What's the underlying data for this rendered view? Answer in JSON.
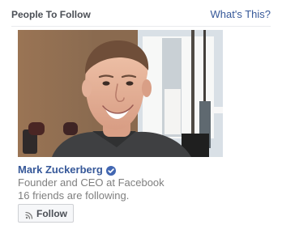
{
  "header": {
    "title": "People To Follow",
    "help_link": "What's This?"
  },
  "suggestion": {
    "name": "Mark Zuckerberg",
    "verified_icon": "verified-badge-icon",
    "description": "Founder and CEO at Facebook",
    "followers_text": "16 friends are following.",
    "follow_button": {
      "icon": "rss-icon",
      "label": "Follow"
    }
  },
  "colors": {
    "link": "#365899",
    "verified": "#4267b2",
    "muted_text": "#7f7f7f",
    "button_background": "#f6f7f9"
  }
}
